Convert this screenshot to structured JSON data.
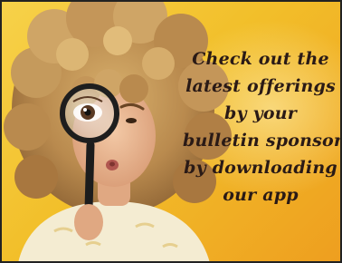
{
  "ad": {
    "headline_lines": [
      "Check out the",
      "latest offerings",
      "by your",
      "bulletin sponsors",
      "by downloading",
      "our app"
    ],
    "colors": {
      "background": "#f2c533",
      "text": "#2a1a16",
      "hair": "#b98a4e",
      "shirt": "#f4ecd2"
    },
    "icon": "magnifying-glass-icon"
  }
}
